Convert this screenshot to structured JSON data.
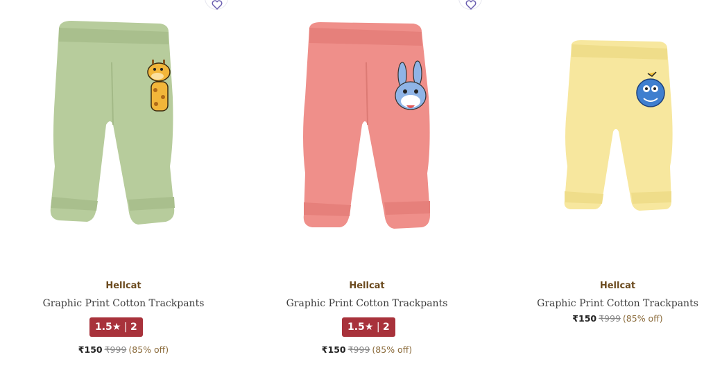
{
  "products": [
    {
      "brand": "Hellcat",
      "title": "Graphic Print Cotton Trackpants",
      "rating": "1.5",
      "rating_count": "2",
      "price": "₹150",
      "mrp": "₹999",
      "discount": "(85% off)",
      "color": "#b7cc9c",
      "graphic": "giraffe"
    },
    {
      "brand": "Hellcat",
      "title": "Graphic Print Cotton Trackpants",
      "rating": "1.5",
      "rating_count": "2",
      "price": "₹150",
      "mrp": "₹999",
      "discount": "(85% off)",
      "color": "#ef8f8a",
      "graphic": "bunny"
    },
    {
      "brand": "Hellcat",
      "title": "Graphic Print Cotton Trackpants",
      "price": "₹150",
      "mrp": "₹999",
      "discount": "(85% off)",
      "color": "#f7e79e",
      "graphic": "blue-monster"
    }
  ],
  "icons": {
    "wishlist": "heart-outline-icon",
    "star": "star-icon"
  }
}
